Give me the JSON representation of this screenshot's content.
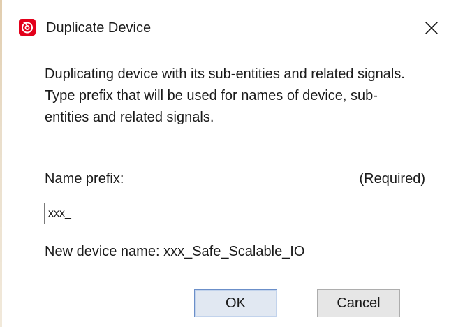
{
  "window": {
    "title": "Duplicate Device",
    "icon": "app-logo-icon",
    "close_glyph": "✕"
  },
  "description": "Duplicating device with its sub-entities and related signals. Type prefix that will be used for names of device, sub-entities and related signals.",
  "prefix_field": {
    "label": "Name prefix:",
    "required_label": "(Required)",
    "value": "xxx_"
  },
  "new_device_name": "New device name: xxx_Safe_Scalable_IO",
  "buttons": {
    "ok_label": "OK",
    "cancel_label": "Cancel"
  },
  "colors": {
    "brand_red": "#e3001b",
    "ok_border": "#6b8fc9",
    "ok_fill": "#e1e8f2"
  }
}
